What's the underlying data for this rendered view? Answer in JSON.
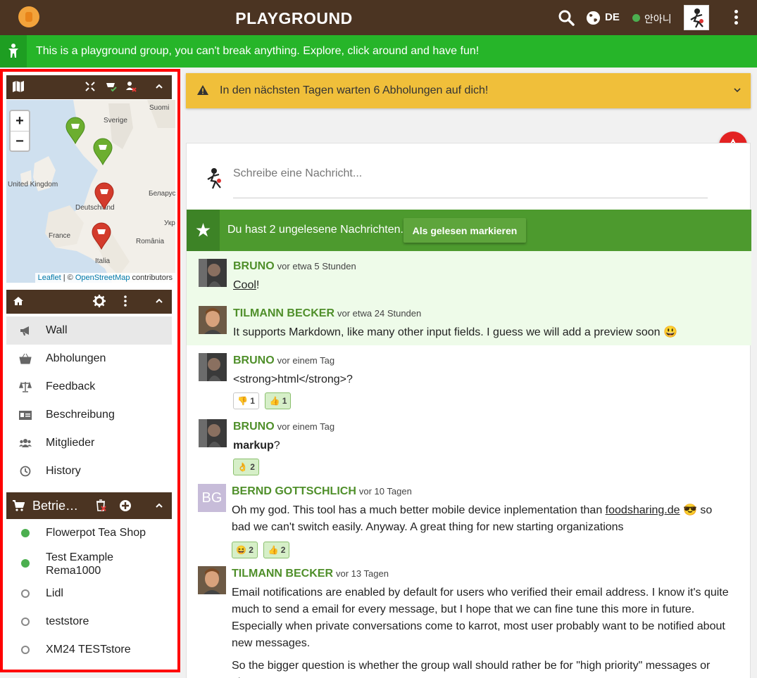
{
  "header": {
    "title": "PLAYGROUND",
    "language": "DE",
    "user_name": "안아니"
  },
  "banner": {
    "text": "This is a playground group, you can't break anything. Explore, click around and have fun!"
  },
  "map": {
    "labels": [
      "Suomi",
      "Sverige",
      "United Kingdom",
      "Deutschland",
      "Беларусь",
      "France",
      "Україна",
      "România",
      "Italia"
    ],
    "attribution_leaflet": "Leaflet",
    "attribution_sep": " | © ",
    "attribution_osm": "OpenStreetMap",
    "attribution_tail": " contributors",
    "zoom_in": "+",
    "zoom_out": "−"
  },
  "nav": {
    "items": [
      {
        "label": "Wall",
        "icon": "megaphone-icon"
      },
      {
        "label": "Abholungen",
        "icon": "basket-icon"
      },
      {
        "label": "Feedback",
        "icon": "balance-scale-icon"
      },
      {
        "label": "Beschreibung",
        "icon": "id-card-icon"
      },
      {
        "label": "Mitglieder",
        "icon": "users-icon"
      },
      {
        "label": "History",
        "icon": "clock-icon"
      }
    ]
  },
  "stores": {
    "title": "Betrie…",
    "items": [
      {
        "label": "Flowerpot Tea Shop",
        "status": "active"
      },
      {
        "label": "Test Example Rema1000",
        "status": "active"
      },
      {
        "label": "Lidl",
        "status": "inactive"
      },
      {
        "label": "teststore",
        "status": "inactive"
      },
      {
        "label": "XM24 TESTstore",
        "status": "inactive"
      }
    ]
  },
  "alert": {
    "text": "In den nächsten Tagen warten 6 Abholungen auf dich!"
  },
  "composer": {
    "placeholder": "Schreibe eine Nachricht..."
  },
  "unread": {
    "text": "Du hast 2 ungelesene Nachrichten.",
    "button": "Als gelesen markieren"
  },
  "messages": [
    {
      "author": "BRUNO",
      "time": "vor etwa 5 Stunden",
      "link": "Cool",
      "text": "!"
    },
    {
      "author": "TILMANN BECKER",
      "time": "vor etwa 24 Stunden",
      "text": "It supports Markdown, like many other input fields. I guess we will add a preview soon 😃"
    },
    {
      "author": "BRUNO",
      "time": "vor einem Tag",
      "text": "<strong>html</strong>?",
      "reactions": [
        {
          "emoji": "👎",
          "count": "1"
        },
        {
          "emoji": "👍",
          "count": "1"
        }
      ]
    },
    {
      "author": "BRUNO",
      "time": "vor einem Tag",
      "bold": "markup",
      "text": "?",
      "reactions": [
        {
          "emoji": "👌",
          "count": "2"
        }
      ]
    },
    {
      "author": "BERND GOTTSCHLICH",
      "initials": "BG",
      "time": "vor 10 Tagen",
      "text_a": "Oh my god. This tool has a much better mobile device inplementation than ",
      "link": "foodsharing.de",
      "text_b": " 😎 so bad we can't switch easily. Anyway. A great thing for new starting organizations",
      "reactions": [
        {
          "emoji": "😆",
          "count": "2"
        },
        {
          "emoji": "👍",
          "count": "2"
        }
      ]
    },
    {
      "author": "TILMANN BECKER",
      "time": "vor 13 Tagen",
      "text": "Email notifications are enabled by default for users who verified their email address. I know it's quite much to send a email for every message, but I hope that we can fine tune this more in future. Especially when private conversations come to karrot, most user probably want to be notified about new messages.",
      "text2": "So the bigger question is whether the group wall should rather be for \"high priority\" messages or also"
    }
  ],
  "colors": {
    "topbar": "#4b3422",
    "banner": "#26b529",
    "alert": "#f0bf3a",
    "unread": "#4d9a2e",
    "author": "#4f8f2a",
    "highlight_border": "#ff0000"
  }
}
